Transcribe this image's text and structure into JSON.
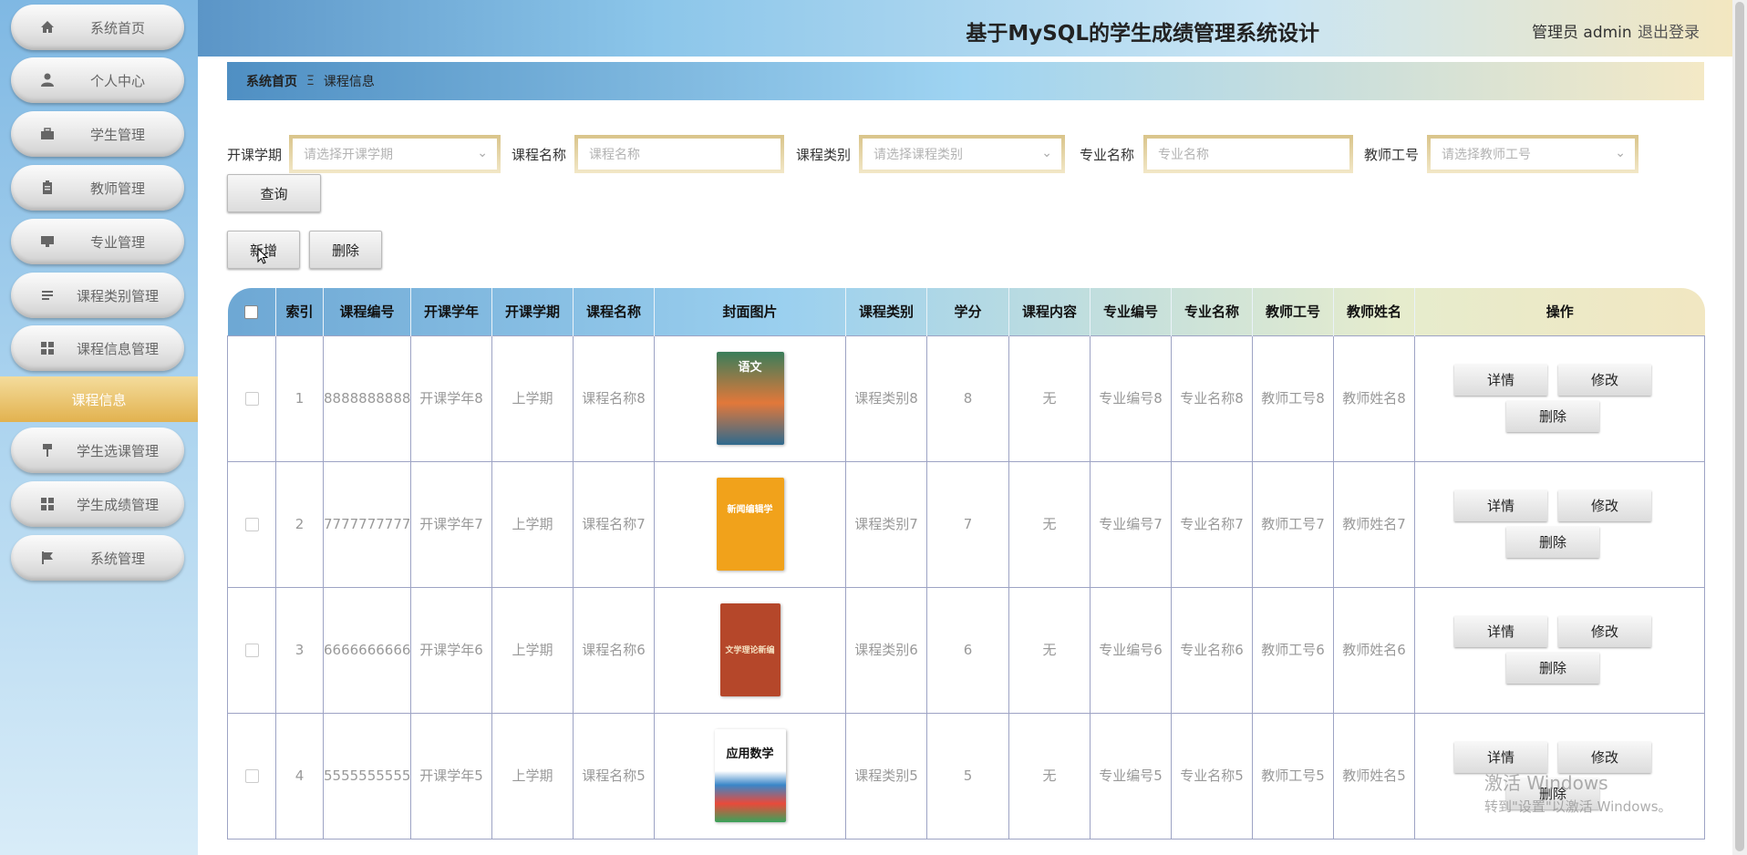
{
  "header": {
    "title": "基于MySQL的学生成绩管理系统设计",
    "admin": "管理员 admin",
    "logout": "退出登录"
  },
  "sidebar": {
    "items": [
      {
        "label": "系统首页",
        "icon": "home-icon"
      },
      {
        "label": "个人中心",
        "icon": "user-icon"
      },
      {
        "label": "学生管理",
        "icon": "briefcase-icon"
      },
      {
        "label": "教师管理",
        "icon": "clipboard-icon"
      },
      {
        "label": "专业管理",
        "icon": "monitor-icon"
      },
      {
        "label": "课程类别管理",
        "icon": "list-icon"
      },
      {
        "label": "课程信息管理",
        "icon": "grid-icon"
      },
      {
        "label": "学生选课管理",
        "icon": "pin-icon"
      },
      {
        "label": "学生成绩管理",
        "icon": "grid-icon"
      },
      {
        "label": "系统管理",
        "icon": "flag-icon"
      }
    ],
    "active_sub": "课程信息"
  },
  "breadcrumb": {
    "home": "系统首页",
    "sep": "Ξ",
    "current": "课程信息"
  },
  "search": {
    "term": {
      "label": "开课学期",
      "placeholder": "请选择开课学期"
    },
    "course_name": {
      "label": "课程名称",
      "placeholder": "课程名称"
    },
    "course_type": {
      "label": "课程类别",
      "placeholder": "请选择课程类别"
    },
    "major_name": {
      "label": "专业名称",
      "placeholder": "专业名称"
    },
    "teacher_no": {
      "label": "教师工号",
      "placeholder": "请选择教师工号"
    },
    "query": "查询"
  },
  "actions": {
    "add": "新增",
    "delete": "删除"
  },
  "table": {
    "headers": [
      "索引",
      "课程编号",
      "开课学年",
      "开课学期",
      "课程名称",
      "封面图片",
      "课程类别",
      "学分",
      "课程内容",
      "专业编号",
      "专业名称",
      "教师工号",
      "教师姓名",
      "操作"
    ],
    "rows": [
      {
        "index": "1",
        "course_no": "8888888888",
        "year": "开课学年8",
        "term": "上学期",
        "name": "课程名称8",
        "category": "课程类别8",
        "credit": "8",
        "content": "无",
        "major_no": "专业编号8",
        "major_name": "专业名称8",
        "teacher_no": "教师工号8",
        "teacher_name": "教师姓名8",
        "cover_title": "语文"
      },
      {
        "index": "2",
        "course_no": "7777777777",
        "year": "开课学年7",
        "term": "上学期",
        "name": "课程名称7",
        "category": "课程类别7",
        "credit": "7",
        "content": "无",
        "major_no": "专业编号7",
        "major_name": "专业名称7",
        "teacher_no": "教师工号7",
        "teacher_name": "教师姓名7",
        "cover_title": "新闻编辑学"
      },
      {
        "index": "3",
        "course_no": "6666666666",
        "year": "开课学年6",
        "term": "上学期",
        "name": "课程名称6",
        "category": "课程类别6",
        "credit": "6",
        "content": "无",
        "major_no": "专业编号6",
        "major_name": "专业名称6",
        "teacher_no": "教师工号6",
        "teacher_name": "教师姓名6",
        "cover_title": "文学理论新编"
      },
      {
        "index": "4",
        "course_no": "5555555555",
        "year": "开课学年5",
        "term": "上学期",
        "name": "课程名称5",
        "category": "课程类别5",
        "credit": "5",
        "content": "无",
        "major_no": "专业编号5",
        "major_name": "专业名称5",
        "teacher_no": "教师工号5",
        "teacher_name": "教师姓名5",
        "cover_title": "应用数学"
      }
    ],
    "row_actions": {
      "detail": "详情",
      "edit": "修改",
      "delete": "删除"
    }
  },
  "watermark": {
    "line1": "激活 Windows",
    "line2": "转到\"设置\"以激活 Windows。"
  },
  "colors": {
    "accent_gold": "#e2b24f",
    "header_blue": "#5b95c7"
  }
}
